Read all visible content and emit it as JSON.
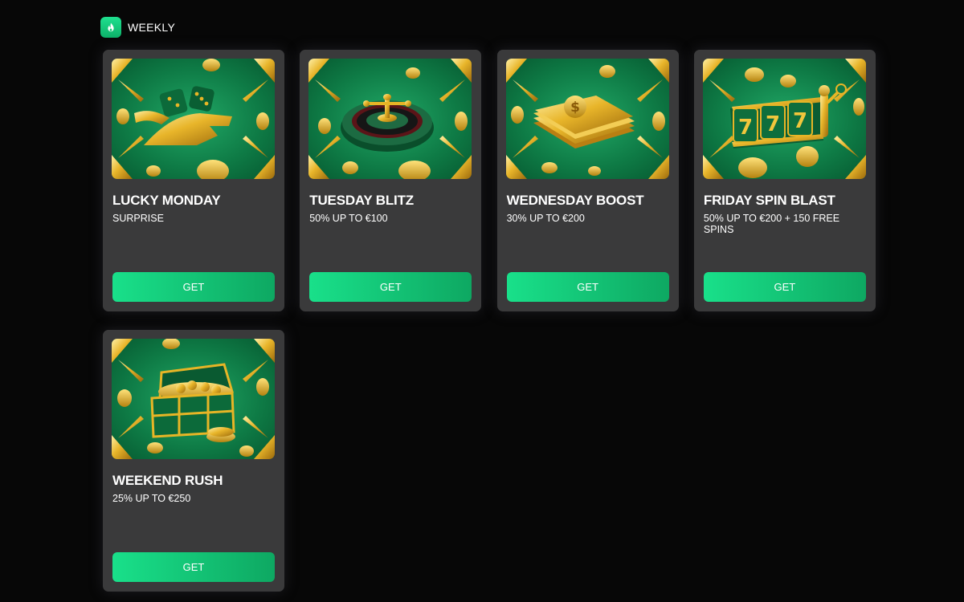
{
  "section": {
    "title": "WEEKLY",
    "icon": "flame-icon",
    "accent_color": "#17d986"
  },
  "cards": [
    {
      "title": "LUCKY MONDAY",
      "subtitle": "SURPRISE",
      "button": "GET",
      "image": "dice-hand"
    },
    {
      "title": "TUESDAY BLITZ",
      "subtitle": "50% UP TO €100",
      "button": "GET",
      "image": "roulette-wheel"
    },
    {
      "title": "WEDNESDAY BOOST",
      "subtitle": "30% UP TO €200",
      "button": "GET",
      "image": "money-stack"
    },
    {
      "title": "FRIDAY SPIN BLAST",
      "subtitle": "50% UP TO €200 + 150 FREE SPINS",
      "button": "GET",
      "image": "slot-machine-777"
    },
    {
      "title": "WEEKEND RUSH",
      "subtitle": "25% UP TO €250",
      "button": "GET",
      "image": "treasure-chest"
    }
  ],
  "colors": {
    "page_background": "#070707",
    "card_background": "#3a3a3b",
    "button_gradient_start": "#19e08a",
    "button_gradient_end": "#0ea862",
    "image_green": "#0f7a46",
    "gold": "#e7b526"
  }
}
